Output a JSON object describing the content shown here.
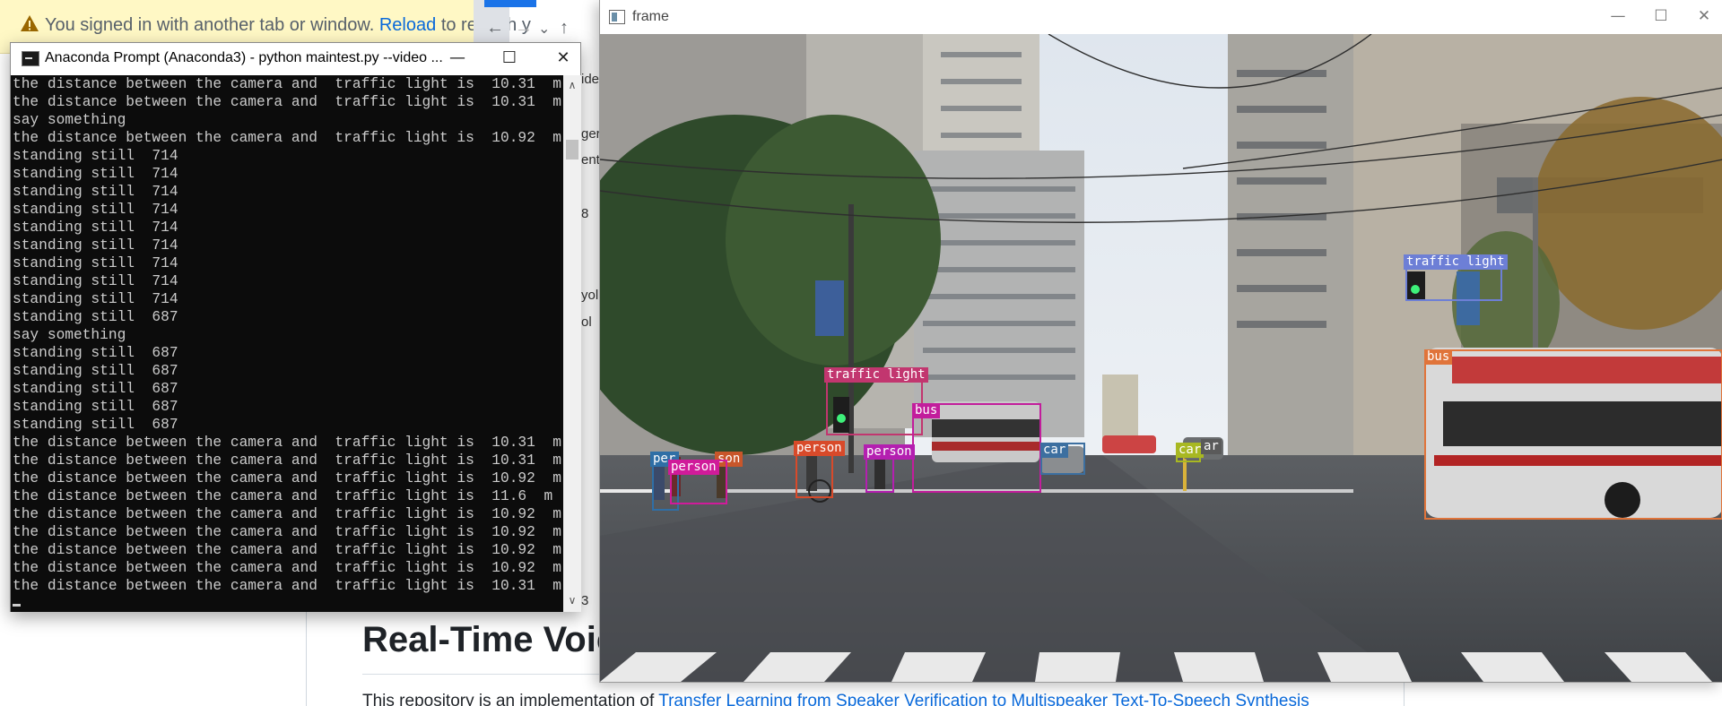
{
  "browser": {
    "notice_text": "You signed in with another tab or window.",
    "notice_link": "Reload",
    "notice_tail": "to refresh y",
    "nav_back": "←",
    "nav_forward": "→",
    "nav_dropdown": "⌄",
    "nav_up": "↑",
    "gutter_snippets": [
      "ide",
      "ger",
      "ents",
      "8",
      "yol",
      "ol",
      "3"
    ]
  },
  "page": {
    "heading": "Real-Time Voic",
    "para_prefix": "This repository is an implementation of",
    "para_link": "Transfer Learning from Speaker Verification to Multispeaker Text-To-Speech Synthesis"
  },
  "conda": {
    "title": "Anaconda Prompt (Anaconda3) - python  maintest.py --video ...",
    "minimize": "—",
    "maximize": "☐",
    "close": "✕",
    "scroll_up": "∧",
    "scroll_down": "∨",
    "lines": [
      "the distance between the camera and  traffic light is  10.31  m",
      "the distance between the camera and  traffic light is  10.31  m",
      "say something",
      "the distance between the camera and  traffic light is  10.92  m",
      "standing still  714",
      "standing still  714",
      "standing still  714",
      "standing still  714",
      "standing still  714",
      "standing still  714",
      "standing still  714",
      "standing still  714",
      "standing still  714",
      "standing still  687",
      "say something",
      "standing still  687",
      "standing still  687",
      "standing still  687",
      "standing still  687",
      "standing still  687",
      "the distance between the camera and  traffic light is  10.31  m",
      "the distance between the camera and  traffic light is  10.31  m",
      "the distance between the camera and  traffic light is  10.92  m",
      "the distance between the camera and  traffic light is  11.6  m",
      "the distance between the camera and  traffic light is  10.92  m",
      "the distance between the camera and  traffic light is  10.92  m",
      "the distance between the camera and  traffic light is  10.92  m",
      "the distance between the camera and  traffic light is  10.92  m",
      "the distance between the camera and  traffic light is  10.31  m"
    ]
  },
  "frame": {
    "title": "frame",
    "minimize": "—",
    "maximize": "☐",
    "close": "✕",
    "detections": [
      {
        "label": "traffic light",
        "color": "#6d7fd6"
      },
      {
        "label": "bus",
        "color": "#e0743a"
      },
      {
        "label": "traffic light",
        "color": "#c2366f"
      },
      {
        "label": "bus",
        "color": "#c21d9c"
      },
      {
        "label": "person",
        "color": "#d84a2a"
      },
      {
        "label": "person",
        "color": "#b41fb0"
      },
      {
        "label": "car",
        "color": "#3c6fa0"
      },
      {
        "label": "car",
        "color": "#a8b822"
      },
      {
        "label": "ar",
        "color": "#5a5a5a"
      },
      {
        "label": "per",
        "color": "#2f6fa6"
      },
      {
        "label": "person",
        "color": "#d01b9a"
      },
      {
        "label": "son",
        "color": "#c8562a"
      }
    ]
  },
  "colors": {
    "notice_bg": "#fff8c5",
    "link": "#0969da",
    "console_bg": "#0c0c0c",
    "console_fg": "#cccccc"
  }
}
